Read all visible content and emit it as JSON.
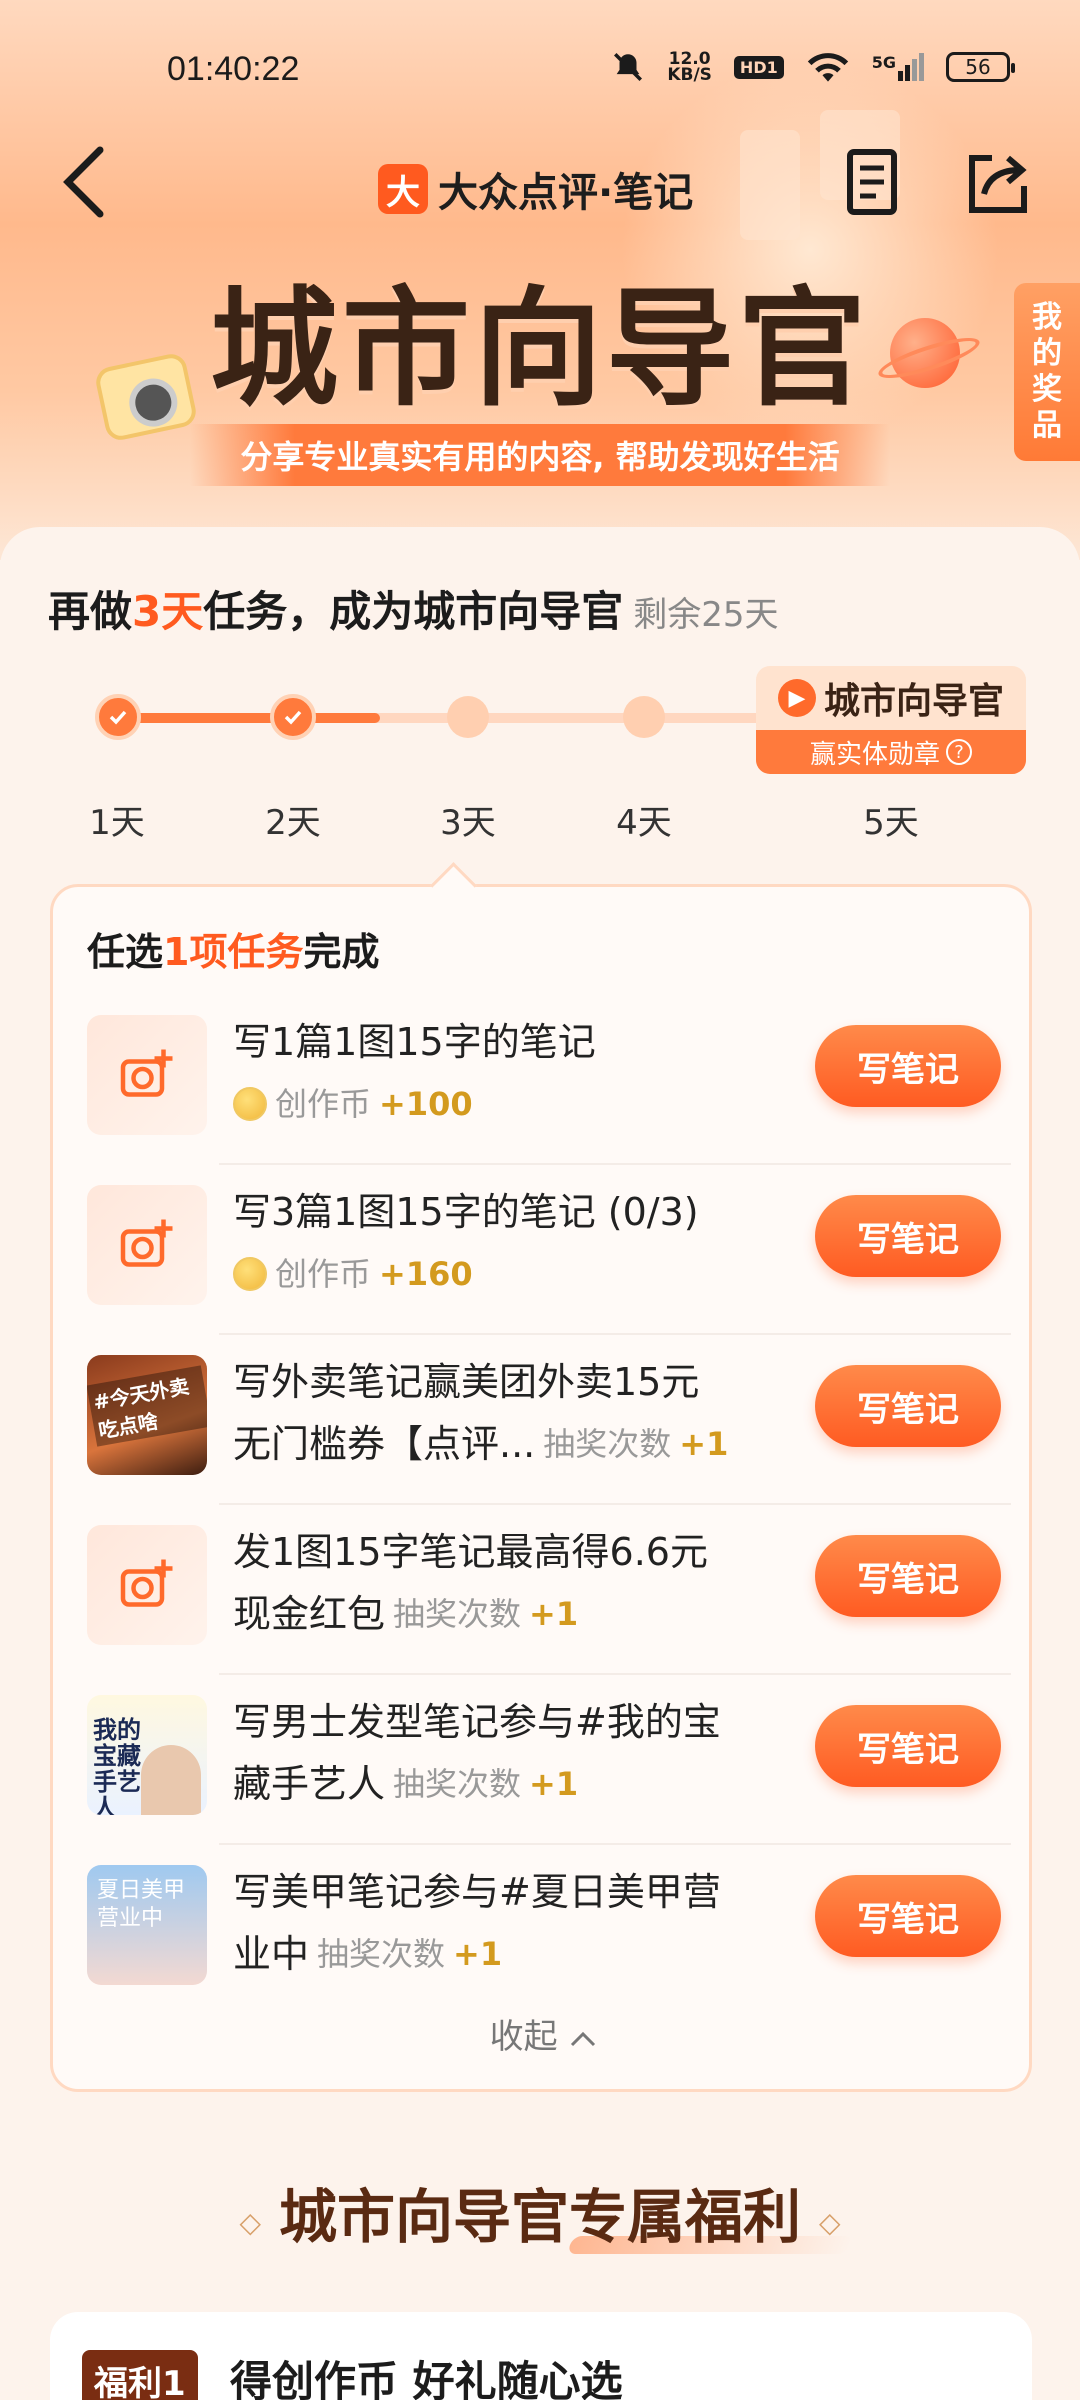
{
  "status_bar": {
    "time": "01:40:22",
    "net_speed_top": "12.0",
    "net_speed_bottom": "KB/S",
    "hd": "HD1",
    "signal": "5G",
    "battery": "56"
  },
  "header": {
    "brand_logo": "大",
    "brand": "大众点评·笔记",
    "hero_title": "城市向导官",
    "slogan": "分享专业真实有用的内容, 帮助发现好生活",
    "prize_tab": [
      "我",
      "的",
      "奖",
      "品"
    ]
  },
  "goal": {
    "prefix": "再做",
    "days": "3天",
    "suffix": "任务，成为城市向导官",
    "remaining": "剩余25天"
  },
  "progress": {
    "days": [
      "1天",
      "2天",
      "3天",
      "4天",
      "5天"
    ],
    "badge_title": "城市向导官",
    "badge_sub": "赢实体勋章",
    "badge_icon": "play-icon",
    "completed_days": 2
  },
  "tasks": {
    "title_prefix": "任选",
    "title_highlight": "1项任务",
    "title_suffix": "完成",
    "items": [
      {
        "line1": "写1篇1图15字的笔记",
        "line2": "",
        "reward_label": "创作币",
        "reward_value": "+100",
        "button": "写笔记"
      },
      {
        "line1": "写3篇1图15字的笔记 (0/3)",
        "line2": "",
        "reward_label": "创作币",
        "reward_value": "+160",
        "button": "写笔记"
      },
      {
        "line1": "写外卖笔记赢美团外卖15元",
        "line2": "无门槛券【点评...",
        "reward_label": "抽奖次数",
        "reward_value": "+1",
        "button": "写笔记",
        "thumb_caption": "#今天外卖吃点啥"
      },
      {
        "line1": "发1图15字笔记最高得6.6元",
        "line2": "现金红包",
        "reward_label": "抽奖次数",
        "reward_value": "+1",
        "button": "写笔记"
      },
      {
        "line1": "写男士发型笔记参与#我的宝",
        "line2": "藏手艺人",
        "reward_label": "抽奖次数",
        "reward_value": "+1",
        "button": "写笔记",
        "thumb_caption": "我的宝藏手艺人"
      },
      {
        "line1": "写美甲笔记参与#夏日美甲营",
        "line2": "业中",
        "reward_label": "抽奖次数",
        "reward_value": "+1",
        "button": "写笔记",
        "thumb_caption": "夏日美甲营业中"
      }
    ],
    "collapse": "收起"
  },
  "benefits": {
    "title": "城市向导官专属福利",
    "card_tag": "福利1",
    "card_title": "得创作币 好礼随心选"
  },
  "colors": {
    "accent": "#ff5a1f",
    "button": "#ff6a2b",
    "reward": "#d39a1e"
  }
}
